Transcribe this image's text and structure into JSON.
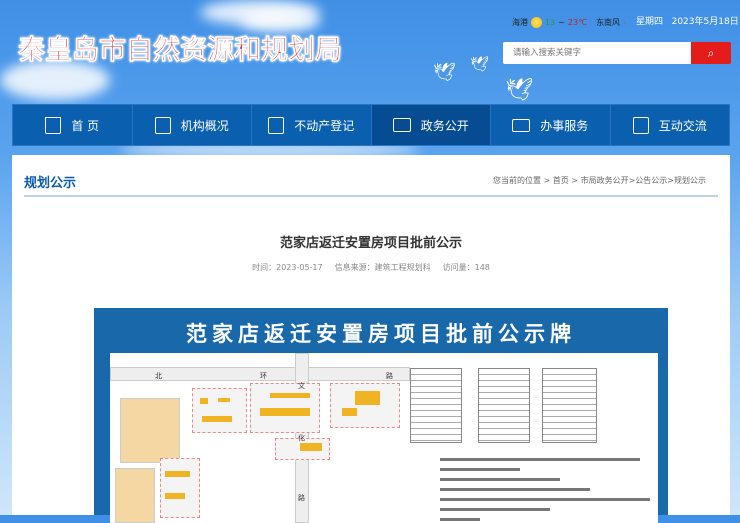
{
  "header": {
    "site_title": "秦皇岛市自然资源和规划局",
    "weather": {
      "city": "海港",
      "temp_low": "13",
      "temp_sep": "~",
      "temp_high": "23℃",
      "wind": "东南风"
    },
    "weekday": "星期四",
    "date": "2023年5月18日",
    "search_placeholder": "请输入搜索关键字",
    "colors": {
      "title": "#d8161b",
      "nav": "#0a5fae",
      "search_button": "#e41d1b"
    }
  },
  "nav": [
    {
      "label": "首 页",
      "icon": "home-icon"
    },
    {
      "label": "机构概况",
      "icon": "org-icon"
    },
    {
      "label": "不动产登记",
      "icon": "document-edit-icon"
    },
    {
      "label": "政务公开",
      "icon": "newspaper-icon",
      "active": true
    },
    {
      "label": "办事服务",
      "icon": "monitor-icon"
    },
    {
      "label": "互动交流",
      "icon": "chat-icon"
    }
  ],
  "section": {
    "title": "规划公示",
    "breadcrumb": "您当前的位置 > 首页 > 市局政务公开>公告公示>规划公示"
  },
  "article": {
    "title": "范家店返迁安置房项目批前公示",
    "time": "时间：2023-05-17",
    "source": "信息来源：建筑工程规划科",
    "views": "访问量：148"
  },
  "board": {
    "title": "范家店返迁安置房项目批前公示牌",
    "road_labels": [
      "北",
      "环",
      "路",
      "文",
      "化",
      "路"
    ]
  }
}
